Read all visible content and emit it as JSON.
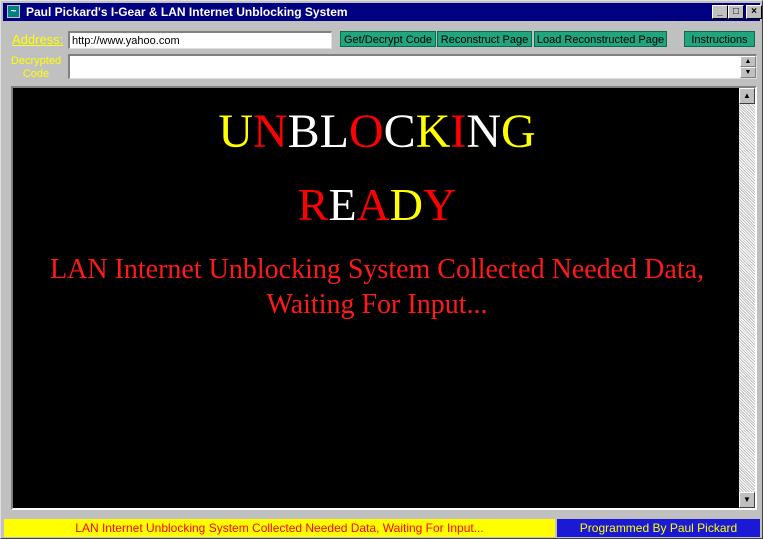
{
  "window": {
    "title": "Paul Pickard's I-Gear & LAN Internet Unblocking System",
    "icon": "app-icon",
    "minimize": "_",
    "maximize": "□",
    "close": "×"
  },
  "address_bar": {
    "label": "Address:",
    "value": "http://www.yahoo.com"
  },
  "toolbar": {
    "decrypt_label": "Get/Decrypt Code",
    "reconstruct_label": "Reconstruct Page",
    "load_label": "Load Reconstructed Page",
    "instructions_label": "Instructions"
  },
  "decrypted": {
    "label": "Decrypted Code",
    "value": ""
  },
  "viewer": {
    "heading_letters": [
      {
        "ch": "U",
        "color": "#ffff00"
      },
      {
        "ch": "N",
        "color": "#ff0000"
      },
      {
        "ch": "B",
        "color": "#ffffff"
      },
      {
        "ch": "L",
        "color": "#ffffff"
      },
      {
        "ch": "O",
        "color": "#ff0000"
      },
      {
        "ch": "C",
        "color": "#ffffff"
      },
      {
        "ch": "K",
        "color": "#ffff00"
      },
      {
        "ch": "I",
        "color": "#ff0000"
      },
      {
        "ch": "N",
        "color": "#ffffff"
      },
      {
        "ch": "G",
        "color": "#ffff00"
      }
    ],
    "status_letters": [
      {
        "ch": "R",
        "color": "#ff0000"
      },
      {
        "ch": "E",
        "color": "#ffffff"
      },
      {
        "ch": "A",
        "color": "#ff0000"
      },
      {
        "ch": "D",
        "color": "#ffff00"
      },
      {
        "ch": "Y",
        "color": "#ff0000"
      }
    ],
    "message": "LAN Internet Unblocking System Collected Needed Data, Waiting For Input..."
  },
  "status_bar": {
    "message": "LAN Internet Unblocking System Collected Needed Data, Waiting For Input...",
    "credit": "Programmed By Paul Pickard"
  },
  "colors": {
    "title_bar": "#000080",
    "button_green": "#21a57f",
    "status_yellow": "#ffff00",
    "status_blue": "#1a1ad6"
  }
}
